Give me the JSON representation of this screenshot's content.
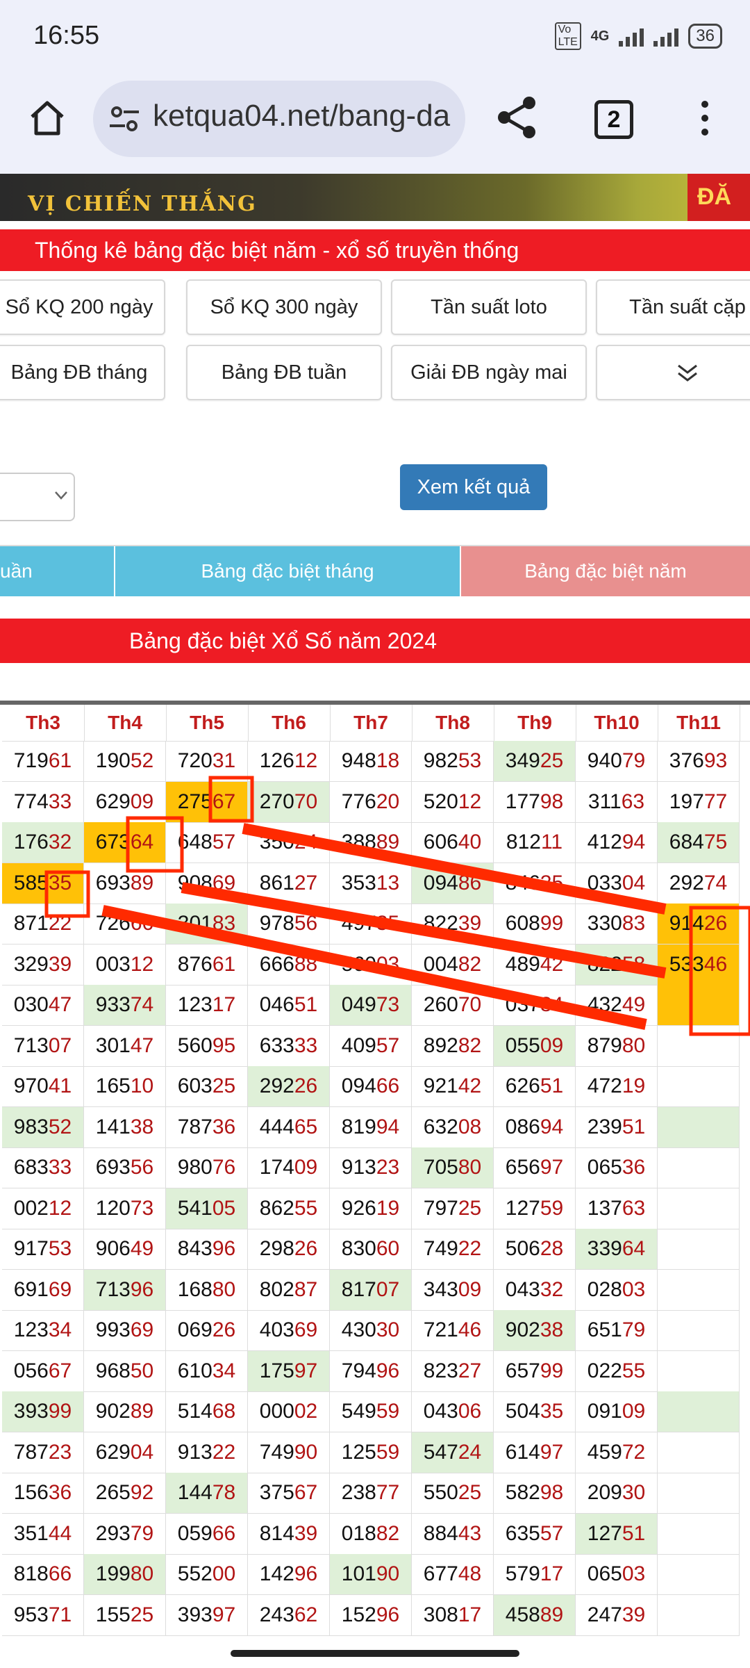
{
  "status": {
    "time": "16:55",
    "volte": "Vo LTE",
    "network": "4G",
    "battery": "36"
  },
  "browser": {
    "url": "ketqua04.net/bang-da",
    "tab_count": "2"
  },
  "banner": {
    "left_text": "VỊ CHIẾN THẮNG",
    "right_text": "ĐĂ"
  },
  "section_title": "Thống kê bảng đặc biệt năm - xổ số truyền thống",
  "nav_buttons": {
    "row1": [
      "Sổ KQ 200 ngày",
      "Sổ KQ 300 ngày",
      "Tần suất loto",
      "Tần suất cặp"
    ],
    "row2": [
      "Bảng ĐB tháng",
      "Bảng ĐB tuần",
      "Giải ĐB ngày mai"
    ]
  },
  "submit_label": "Xem kết quả",
  "tabs": [
    "uần",
    "Bảng đặc biệt tháng",
    "Bảng đặc biệt năm"
  ],
  "year_title": "Bảng đặc biệt Xổ Số năm 2024",
  "colors": {
    "red": "#ee1c24",
    "tab_blue": "#5bc0de",
    "tab_pink": "#e8908f",
    "button_blue": "#337ab7",
    "highlight": "#ffc107",
    "green_cell": "#dff0d8",
    "annotation": "#ff2a00"
  },
  "table": {
    "headers": [
      "Th3",
      "Th4",
      "Th5",
      "Th6",
      "Th7",
      "Th8",
      "Th9",
      "Th10",
      "Th11"
    ],
    "columns": [
      {
        "cells": [
          "71961",
          "77433",
          "17632",
          "58535",
          "87122",
          "32939",
          "03047",
          "71307",
          "97041",
          "98352",
          "68333",
          "00212",
          "91753",
          "69169",
          "12334",
          "05667",
          "39399",
          "78723",
          "15636",
          "35144",
          "81866",
          "95371"
        ],
        "green": [
          2,
          9,
          16
        ],
        "orange": [
          3
        ]
      },
      {
        "cells": [
          "19052",
          "62909",
          "67364",
          "69389",
          "72666",
          "00312",
          "93374",
          "30147",
          "16510",
          "14138",
          "69356",
          "12073",
          "90649",
          "71396",
          "99369",
          "96850",
          "90289",
          "62904",
          "26592",
          "29379",
          "19980",
          "15525"
        ],
        "green": [
          6,
          13,
          20
        ],
        "orange": [
          2
        ]
      },
      {
        "cells": [
          "72031",
          "27567",
          "64857",
          "90869",
          "30183",
          "87661",
          "12317",
          "56095",
          "60325",
          "78736",
          "98076",
          "54105",
          "84396",
          "16880",
          "06926",
          "61034",
          "51468",
          "91322",
          "14478",
          "05966",
          "55200",
          "39397"
        ],
        "green": [
          4,
          11,
          18
        ],
        "orange": [
          1
        ]
      },
      {
        "cells": [
          "12612",
          "27070",
          "35024",
          "86127",
          "97856",
          "66688",
          "04651",
          "63333",
          "29226",
          "44465",
          "17409",
          "86255",
          "29826",
          "80287",
          "40369",
          "17597",
          "00002",
          "74990",
          "37567",
          "81439",
          "14296",
          "24362"
        ],
        "green": [
          1,
          8,
          15
        ],
        "orange": []
      },
      {
        "cells": [
          "94818",
          "77620",
          "38889",
          "35313",
          "49735",
          "56003",
          "04973",
          "40957",
          "09466",
          "81994",
          "91323",
          "92619",
          "83060",
          "81707",
          "43030",
          "79496",
          "54959",
          "12559",
          "23877",
          "01882",
          "10190",
          "15296"
        ],
        "green": [
          6,
          13,
          20
        ],
        "orange": []
      },
      {
        "cells": [
          "98253",
          "52012",
          "60640",
          "09486",
          "82239",
          "00482",
          "26070",
          "89282",
          "92142",
          "63208",
          "70580",
          "79725",
          "74922",
          "34309",
          "72146",
          "82327",
          "04306",
          "54724",
          "55025",
          "88443",
          "67748",
          "30817"
        ],
        "green": [
          3,
          10,
          17
        ],
        "orange": []
      },
      {
        "cells": [
          "34925",
          "17798",
          "81211",
          "84635",
          "60899",
          "48942",
          "03784",
          "05509",
          "62651",
          "08694",
          "65697",
          "12759",
          "50628",
          "04332",
          "90238",
          "65799",
          "50435",
          "61497",
          "58298",
          "63557",
          "57917",
          "45889"
        ],
        "green": [
          0,
          7,
          14,
          21
        ],
        "orange": []
      },
      {
        "cells": [
          "94079",
          "31163",
          "41294",
          "03304",
          "33083",
          "82258",
          "43249",
          "87980",
          "47219",
          "23951",
          "06536",
          "13763",
          "33964",
          "02803",
          "65179",
          "02255",
          "09109",
          "45972",
          "20930",
          "12751",
          "06503",
          "24739"
        ],
        "green": [
          5,
          12,
          19
        ],
        "orange": []
      },
      {
        "cells": [
          "37693",
          "19777",
          "68475",
          "29274",
          "91426",
          "53346",
          "",
          "",
          "",
          "",
          "",
          "",
          "",
          "",
          "",
          "",
          "",
          "",
          "",
          "",
          "",
          ""
        ],
        "green": [
          2,
          9,
          16
        ],
        "orange": [
          4,
          5,
          6
        ]
      }
    ]
  }
}
